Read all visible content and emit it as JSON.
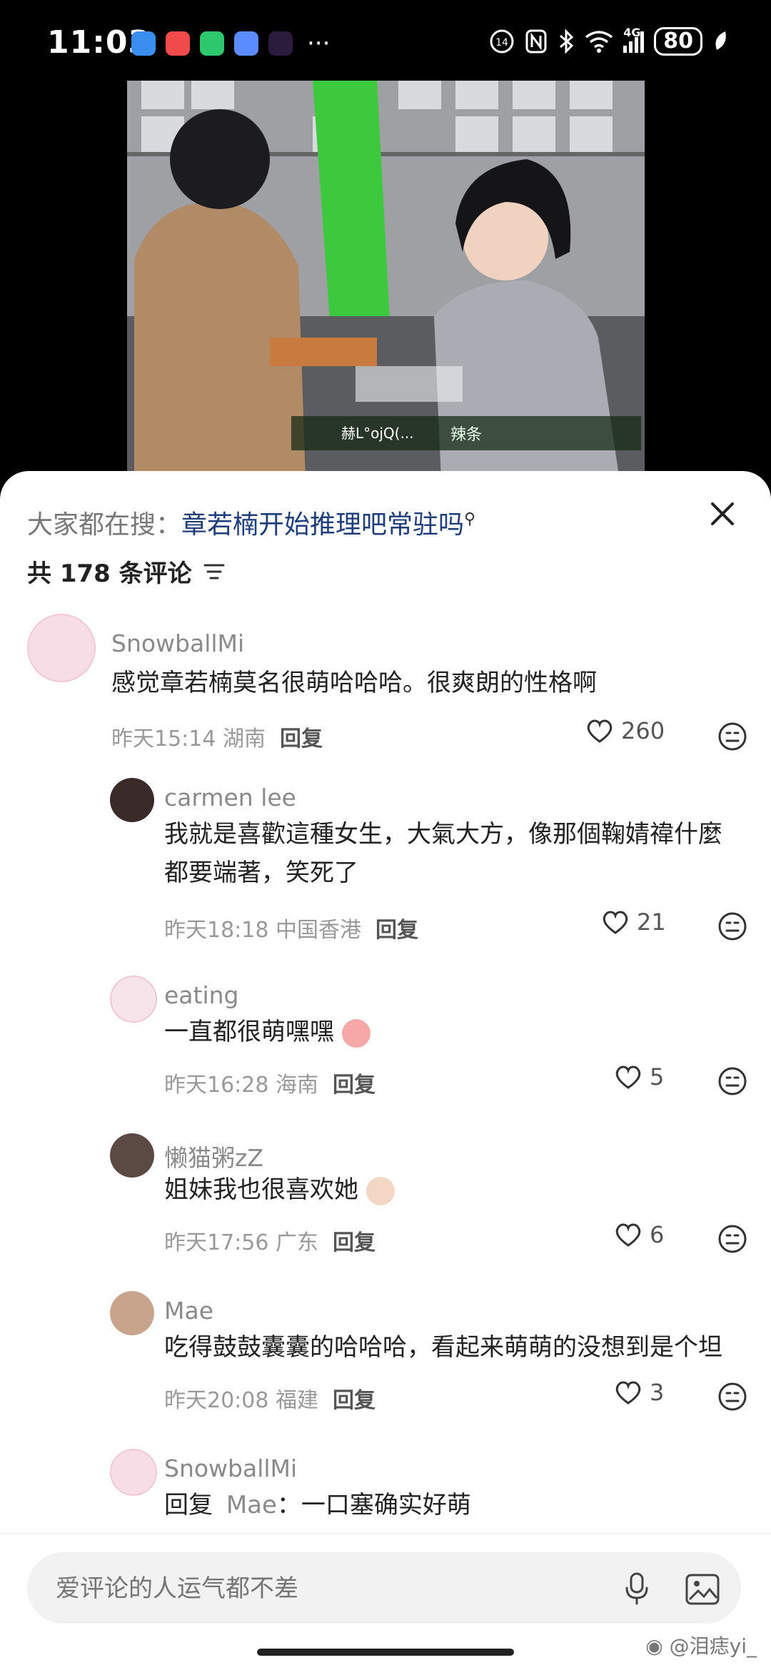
{
  "status": {
    "time": "11:03",
    "dots": "···",
    "net": "4G",
    "battery": "80"
  },
  "video": {
    "subtitle_left": "赫L°ojQ(...",
    "subtitle": "辣条"
  },
  "header": {
    "search_prefix": "大家都在搜：",
    "search_term": "章若楠开始推理吧常驻吗",
    "count_label": "共 178 条评论"
  },
  "comments": [
    {
      "name": "SnowballMi",
      "text": "感觉章若楠莫名很萌哈哈哈。很爽朗的性格啊",
      "time": "昨天15:14 湖南",
      "reply": "回复",
      "likes": "260"
    },
    {
      "name": "carmen lee",
      "text": "我就是喜歡這種女生，大氣大方，像那個鞠婧禕什麼都要端著，笑死了",
      "time": "昨天18:18 中国香港",
      "reply": "回复",
      "likes": "21"
    },
    {
      "name": "eating",
      "text": "一直都很萌嘿嘿",
      "time": "昨天16:28 海南",
      "reply": "回复",
      "likes": "5"
    },
    {
      "name": "懒猫粥zZ",
      "text": "姐妹我也很喜欢她",
      "time": "昨天17:56 广东",
      "reply": "回复",
      "likes": "6"
    },
    {
      "name": "Mae",
      "text": "吃得鼓鼓囊囊的哈哈哈，看起来萌萌的没想到是个坦",
      "time": "昨天20:08 福建",
      "reply": "回复",
      "likes": "3"
    },
    {
      "name": "SnowballMi",
      "reply_prefix": "回复",
      "reply_to": "Mae",
      "text": "一口塞确实好萌"
    }
  ],
  "composer": {
    "placeholder": "爱评论的人运气都不差"
  },
  "watermark": "@泪痣yi_"
}
